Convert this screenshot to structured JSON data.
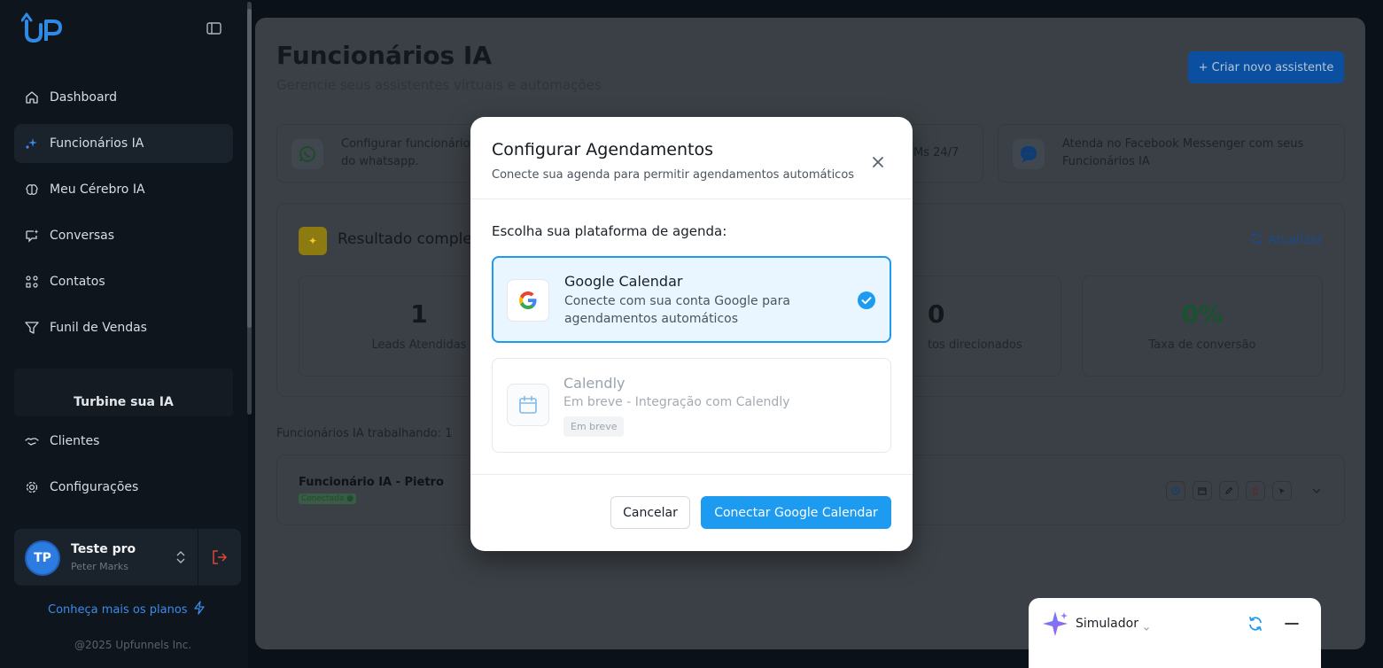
{
  "brand": {
    "logo_text": "UP"
  },
  "sidebar": {
    "items": [
      {
        "label": "Dashboard",
        "icon": "home-icon",
        "active": false
      },
      {
        "label": "Funcionários IA",
        "icon": "sparkles-icon",
        "active": true
      },
      {
        "label": "Meu Cérebro IA",
        "icon": "brain-icon",
        "active": false
      },
      {
        "label": "Conversas",
        "icon": "chat-icon",
        "active": false
      },
      {
        "label": "Contatos",
        "icon": "contacts-icon",
        "active": false
      },
      {
        "label": "Funil de Vendas",
        "icon": "funnel-icon",
        "active": false
      }
    ],
    "promo": "Turbine sua IA",
    "items2": [
      {
        "label": "Clientes",
        "icon": "handshake-icon"
      },
      {
        "label": "Configurações",
        "icon": "gear-icon"
      }
    ],
    "user": {
      "initials": "TP",
      "name": "Teste pro",
      "subtitle": "Peter Marks"
    },
    "plans_link": "Conheça mais os planos",
    "copyright": "@2025 Upfunnels Inc."
  },
  "main": {
    "title": "Funcionários IA",
    "subtitle": "Gerencie seus assistentes virtuais e automações",
    "create_button": "+ Criar novo assistente",
    "features": [
      {
        "line1": "Configurar funcionário I",
        "line2": "do whatsapp."
      },
      {
        "line1": "Ms 24/7",
        "line2": ""
      },
      {
        "line1": "Atenda no Facebook Messenger com seus",
        "line2": "Funcionários IA"
      }
    ],
    "results": {
      "title": "Resultado complet",
      "refresh_label": "Atualizar",
      "stats": [
        {
          "value": "1",
          "label": "Leads Atendidas"
        },
        {
          "value": "0",
          "label": "tos direcionados"
        },
        {
          "value": "0%",
          "label": "Taxa de conversão"
        }
      ]
    },
    "working_label": "Funcionários IA trabalhando: 1",
    "agent": {
      "name": "Funcionário IA - Pietro",
      "status": "Conectada ●"
    }
  },
  "modal": {
    "title": "Configurar Agendamentos",
    "subtitle": "Conecte sua agenda para permitir agendamentos automáticos",
    "choose_label": "Escolha sua plataforma de agenda:",
    "options": [
      {
        "title": "Google Calendar",
        "desc": "Conecte com sua conta Google para agendamentos automáticos",
        "selected": true
      },
      {
        "title": "Calendly",
        "desc": "Em breve - Integração com Calendly",
        "badge": "Em breve",
        "selected": false
      }
    ],
    "cancel_label": "Cancelar",
    "connect_label": "Conectar Google Calendar"
  },
  "simulator": {
    "label": "Simulador"
  },
  "colors": {
    "accent": "#1d9bf0",
    "success": "#22c55e",
    "brand_blue": "#2c7be0"
  }
}
